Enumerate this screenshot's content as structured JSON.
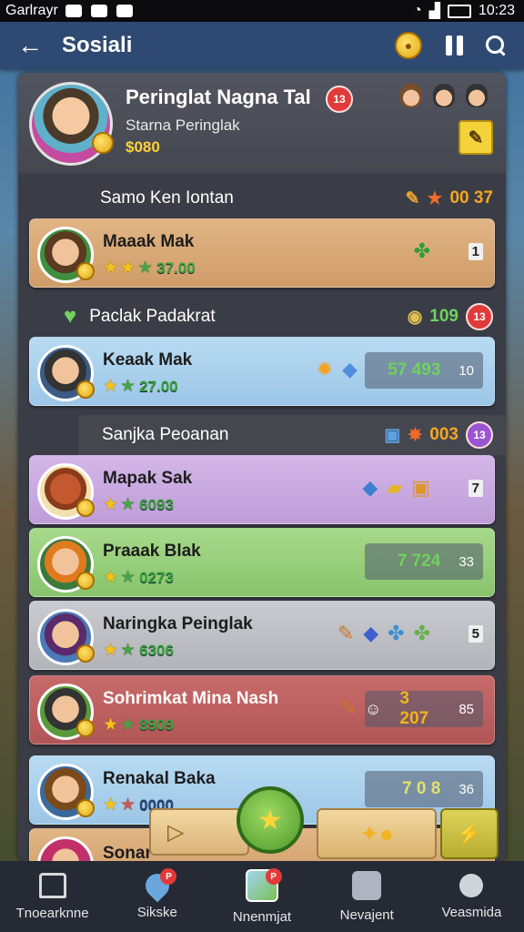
{
  "status": {
    "carrier": "Garlrayr",
    "time": "10:23"
  },
  "appbar": {
    "title": "Sosiali"
  },
  "profile": {
    "title": "Peringlat Nagna Tal",
    "subtitle": "Starna Peringlak",
    "score": "$080",
    "badge": "13"
  },
  "sections": [
    {
      "label": "Samo Ken Iontan",
      "value": "00 37"
    },
    {
      "label": "Paclak Padakrat",
      "value": "109",
      "badge": "13"
    },
    {
      "label": "Sanjka Peoanan",
      "value": "003",
      "badge": "13"
    }
  ],
  "rows": [
    {
      "name": "Maaak Mak",
      "stars": "37.00",
      "rank": "1",
      "color": "#e1b585"
    },
    {
      "name": "Keaak Mak",
      "stars": "27.00",
      "score": "57 493",
      "rank": "10",
      "color": "#b8dbf2"
    },
    {
      "name": "Mapak Sak",
      "stars": "6093",
      "rank": "7",
      "color": "#d4b6e8"
    },
    {
      "name": "Praaak Blak",
      "stars": "0273",
      "score": "7 724",
      "rank": "33",
      "color": "#a7d98b"
    },
    {
      "name": "Naringka Peinglak",
      "stars": "6306",
      "rank": "5",
      "color": "#c9cbd0"
    },
    {
      "name": "Sohrimkat Mina Nash",
      "stars": "8909",
      "score": "3 207",
      "rank": "85",
      "color": "#c76a6a"
    },
    {
      "name": "Renakal Baka",
      "stars": "0000",
      "score": "7 0 8",
      "rank": "36",
      "color": "#b8dbf2"
    },
    {
      "name": "Sonar"
    }
  ],
  "bottom_nav": [
    {
      "label": "Tnoearknne",
      "icon": "home-icon"
    },
    {
      "label": "Sikske",
      "icon": "map-pin-icon",
      "badge": "P"
    },
    {
      "label": "Nnenmjat",
      "icon": "map-icon",
      "badge": "P"
    },
    {
      "label": "Nevajent",
      "icon": "calendar-icon"
    },
    {
      "label": "Veasmida",
      "icon": "person-icon"
    }
  ]
}
